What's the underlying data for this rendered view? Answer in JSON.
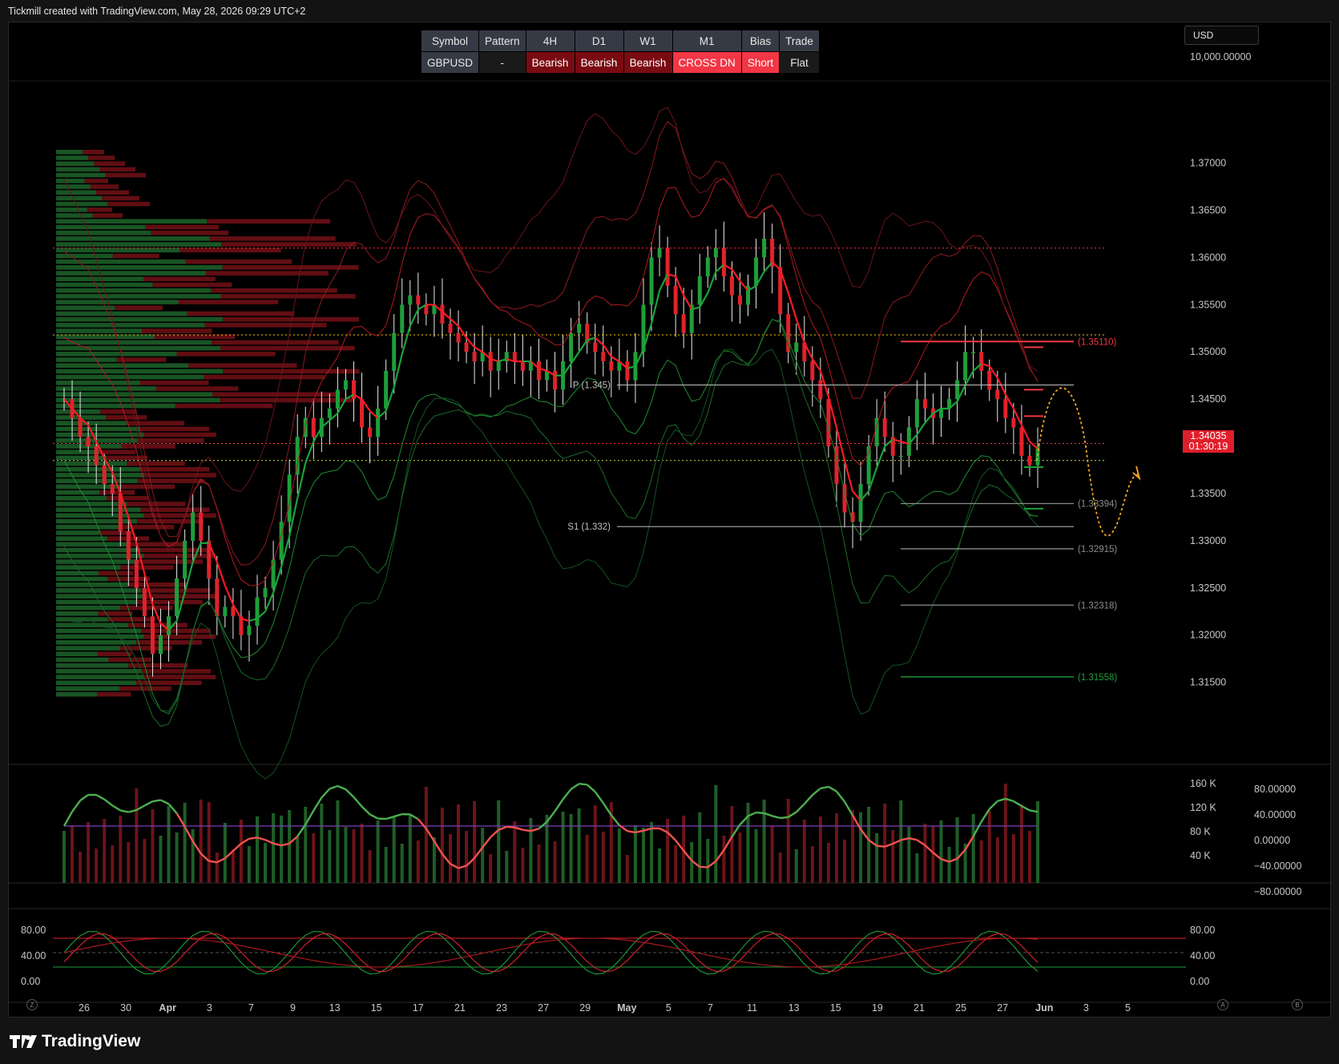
{
  "header": {
    "attribution": "Tickmill created with TradingView.com, May 28, 2026 09:29 UTC+2"
  },
  "footer": {
    "brand": "TradingView"
  },
  "currency": "USD",
  "table": {
    "headers": [
      "Symbol",
      "Pattern",
      "4H",
      "D1",
      "W1",
      "M1",
      "Bias",
      "Trade"
    ],
    "values": [
      "GBPUSD",
      "-",
      "Bearish",
      "Bearish",
      "Bearish",
      "CROSS DN",
      "Short",
      "Flat"
    ]
  },
  "colors": {
    "bull": "#1e9e3a",
    "bear": "#e0222b",
    "accent_red": "#f23645",
    "accent_orange": "#f5a524"
  },
  "last_price": {
    "price": "1.34035",
    "countdown": "01:30:19"
  },
  "scale_buttons": {
    "log": "Z",
    "auto": "A",
    "b": "B"
  },
  "chart_data": [
    {
      "type": "candlestick",
      "symbol": "GBPUSD",
      "y_axis_top_label": "10,000.00000",
      "y_ticks": [
        "1.37000",
        "1.36500",
        "1.36000",
        "1.35500",
        "1.35000",
        "1.34500",
        "1.34000",
        "1.33500",
        "1.33000",
        "1.32500",
        "1.32000",
        "1.31500"
      ],
      "ylim": [
        1.312,
        1.3765
      ],
      "x_ticks": [
        "26",
        "30",
        "Apr",
        "3",
        "7",
        "9",
        "13",
        "15",
        "17",
        "21",
        "23",
        "27",
        "29",
        "May",
        "5",
        "7",
        "11",
        "13",
        "15",
        "19",
        "21",
        "25",
        "27",
        "Jun",
        "3",
        "5"
      ],
      "close_path": [
        1.345,
        1.343,
        1.341,
        1.34,
        1.338,
        1.336,
        1.335,
        1.331,
        1.328,
        1.325,
        1.322,
        1.318,
        1.32,
        1.322,
        1.326,
        1.33,
        1.333,
        1.33,
        1.326,
        1.322,
        1.323,
        1.322,
        1.32,
        1.321,
        1.324,
        1.325,
        1.328,
        1.332,
        1.337,
        1.341,
        1.343,
        1.341,
        1.343,
        1.344,
        1.346,
        1.347,
        1.345,
        1.342,
        1.341,
        1.344,
        1.348,
        1.352,
        1.355,
        1.356,
        1.355,
        1.354,
        1.355,
        1.353,
        1.352,
        1.351,
        1.35,
        1.349,
        1.35,
        1.348,
        1.349,
        1.35,
        1.349,
        1.348,
        1.349,
        1.347,
        1.348,
        1.346,
        1.349,
        1.352,
        1.353,
        1.351,
        1.35,
        1.349,
        1.348,
        1.349,
        1.347,
        1.35,
        1.355,
        1.36,
        1.361,
        1.357,
        1.354,
        1.352,
        1.355,
        1.358,
        1.36,
        1.361,
        1.358,
        1.356,
        1.355,
        1.357,
        1.36,
        1.362,
        1.359,
        1.354,
        1.35,
        1.351,
        1.349,
        1.347,
        1.345,
        1.34,
        1.336,
        1.333,
        1.332,
        1.336,
        1.34,
        1.343,
        1.341,
        1.339,
        1.339,
        1.342,
        1.345,
        1.344,
        1.343,
        1.344,
        1.345,
        1.347,
        1.35,
        1.35,
        1.348,
        1.346,
        1.345,
        1.343,
        1.342,
        1.339,
        1.338,
        1.34
      ],
      "bands_note": "Bollinger style envelopes (red upper, green lower)",
      "levels": [
        {
          "label": "(1.35110)",
          "value": 1.3511,
          "color": "#f23645"
        },
        {
          "label": "P (1.345)",
          "value": 1.3465,
          "color": "#bfbfbf"
        },
        {
          "label": "(1.33394)",
          "value": 1.33394,
          "color": "#8c8c8c"
        },
        {
          "label": "S1 (1.332)",
          "value": 1.3315,
          "color": "#bfbfbf"
        },
        {
          "label": "(1.32915)",
          "value": 1.32915,
          "color": "#8c8c8c"
        },
        {
          "label": "(1.32318)",
          "value": 1.32318,
          "color": "#8c8c8c"
        },
        {
          "label": "(1.31558)",
          "value": 1.31558,
          "color": "#1e9e3a"
        }
      ],
      "dotted_levels": [
        {
          "value": 1.361,
          "color": "#f23645"
        },
        {
          "value": 1.3518,
          "color": "#f5c400"
        },
        {
          "value": 1.3403,
          "color": "#f23645"
        },
        {
          "value": 1.3385,
          "color": "#c6e04a"
        }
      ],
      "projection_note": "dotted orange projected path: up to ~1.3465 then down to ~1.331 then up"
    },
    {
      "type": "bar+line",
      "name": "volume oscillator",
      "y_ticks_left": [
        "160 K",
        "120 K",
        "80 K",
        "40 K"
      ],
      "y_ticks_right": [
        "80.00000",
        "40.00000",
        "0.00000",
        "−40.00000",
        "−80.00000"
      ],
      "ylim_right": [
        -90,
        90
      ]
    },
    {
      "type": "line",
      "name": "stochastic",
      "y_ticks": [
        "80.00",
        "40.00",
        "0.00"
      ],
      "ylim": [
        0,
        100
      ],
      "upper": 80,
      "lower": 20
    }
  ]
}
